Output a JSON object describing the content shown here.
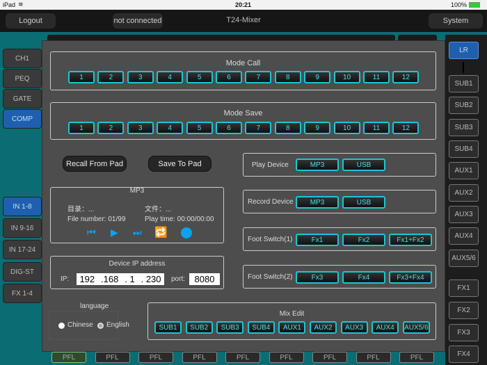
{
  "status": {
    "device": "iPad",
    "time": "20:21",
    "battery": "100%"
  },
  "header": {
    "logout": "Logout",
    "connection": "not connected",
    "title": "T24-Mixer",
    "system": "System"
  },
  "left_top": [
    "CH1",
    "PEQ",
    "GATE",
    "COMP"
  ],
  "left_bottom": [
    "IN 1-8",
    "IN 9-16",
    "IN 17-24",
    "DIG-ST",
    "FX 1-4"
  ],
  "right": [
    "LR",
    "SUB1",
    "SUB2",
    "SUB3",
    "SUB4",
    "AUX1",
    "AUX2",
    "AUX3",
    "AUX4",
    "AUX5/6",
    "FX1",
    "FX2",
    "FX3",
    "FX4"
  ],
  "mode_call": {
    "title": "Mode Call",
    "buttons": [
      "1",
      "2",
      "3",
      "4",
      "5",
      "6",
      "7",
      "8",
      "9",
      "10",
      "11",
      "12"
    ]
  },
  "mode_save": {
    "title": "Mode Save",
    "buttons": [
      "1",
      "2",
      "3",
      "4",
      "5",
      "6",
      "7",
      "8",
      "9",
      "10",
      "11",
      "12"
    ]
  },
  "recall": "Recall From Pad",
  "save": "Save To Pad",
  "play_device": {
    "label": "Play Device",
    "buttons": [
      "MP3",
      "USB"
    ]
  },
  "record_device": {
    "label": "Record Device",
    "buttons": [
      "MP3",
      "USB"
    ]
  },
  "foot1": {
    "label": "Foot Switch(1)",
    "buttons": [
      "Fx1",
      "Fx2",
      "Fx1+Fx2"
    ]
  },
  "foot2": {
    "label": "Foot Switch(2)",
    "buttons": [
      "Fx3",
      "Fx4",
      "Fx3+Fx4"
    ]
  },
  "mp3": {
    "title": "MP3",
    "dir": "目录：...",
    "file": "文件：...",
    "file_number": "File number: 01/99",
    "play_time": "Play time: 00:00/00:00"
  },
  "ip": {
    "title": "Device IP address",
    "ip_label": "IP:",
    "octets": [
      "192",
      ".168",
      ".   1",
      ". 230"
    ],
    "port_label": "port:",
    "port": "8080"
  },
  "language": {
    "title": "language",
    "options": [
      "Chinese",
      "English"
    ],
    "selected": "English"
  },
  "mix_edit": {
    "title": "Mix Edit",
    "buttons": [
      "SUB1",
      "SUB2",
      "SUB3",
      "SUB4",
      "AUX1",
      "AUX2",
      "AUX3",
      "AUX4",
      "AUX5/6"
    ]
  },
  "pfl": [
    "PFL",
    "PFL",
    "PFL",
    "PFL",
    "PFL",
    "PFL",
    "PFL",
    "PFL",
    "PFL"
  ],
  "colors": {
    "accent": "#19c7d6",
    "blue": "#1f5fb0",
    "icon": "#0aa3f0"
  }
}
